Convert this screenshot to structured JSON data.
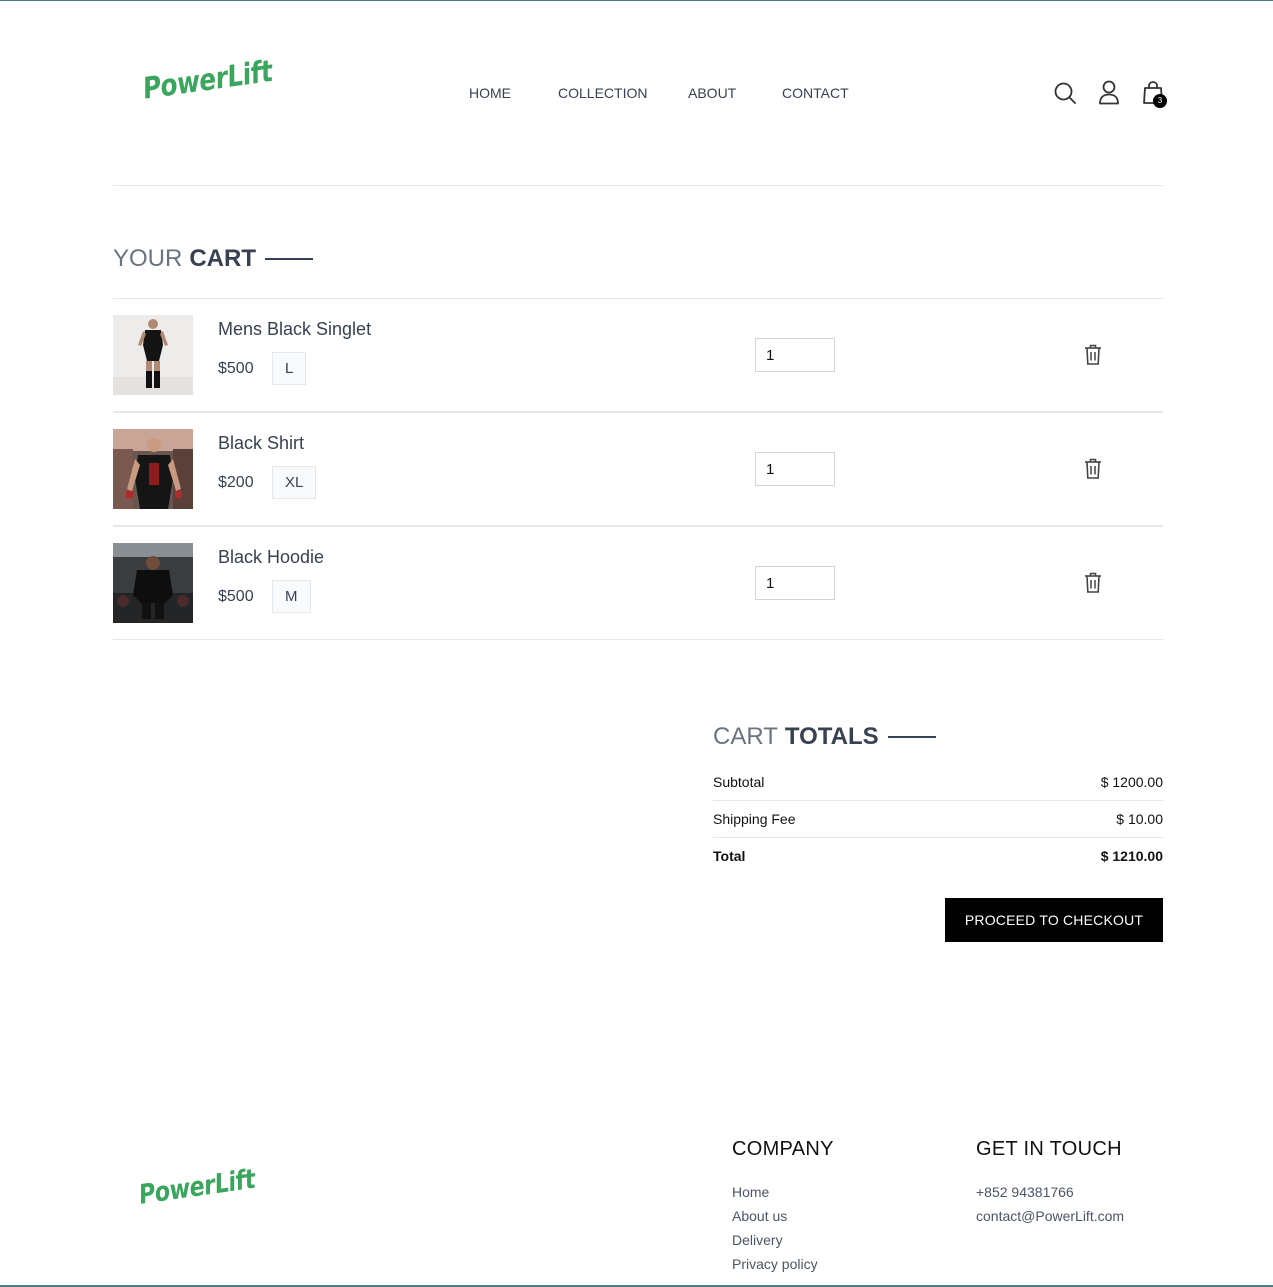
{
  "brand": {
    "name": "PowerLift",
    "color": "#3aa65d"
  },
  "nav": {
    "home": "HOME",
    "collection": "COLLECTION",
    "about": "ABOUT",
    "contact": "CONTACT"
  },
  "header": {
    "cart_count": "3",
    "icons": [
      "search-icon",
      "user-icon",
      "shopping-bag-icon"
    ]
  },
  "cart": {
    "title_light": "YOUR",
    "title_bold": "CART",
    "items": [
      {
        "name": "Mens Black Singlet",
        "price": "$500",
        "size": "L",
        "quantity": "1"
      },
      {
        "name": "Black Shirt",
        "price": "$200",
        "size": "XL",
        "quantity": "1"
      },
      {
        "name": "Black Hoodie",
        "price": "$500",
        "size": "M",
        "quantity": "1"
      }
    ]
  },
  "totals": {
    "title_light": "CART",
    "title_bold": "TOTALS",
    "subtotal_label": "Subtotal",
    "subtotal_value": "$ 1200.00",
    "shipping_label": "Shipping Fee",
    "shipping_value": "$ 10.00",
    "total_label": "Total",
    "total_value": "$ 1210.00",
    "checkout_label": "PROCEED TO CHECKOUT"
  },
  "footer": {
    "company_heading": "COMPANY",
    "company_links": [
      "Home",
      "About us",
      "Delivery",
      "Privacy policy"
    ],
    "contact_heading": "GET IN TOUCH",
    "phone": "+852 94381766",
    "email": "contact@PowerLift.com"
  }
}
